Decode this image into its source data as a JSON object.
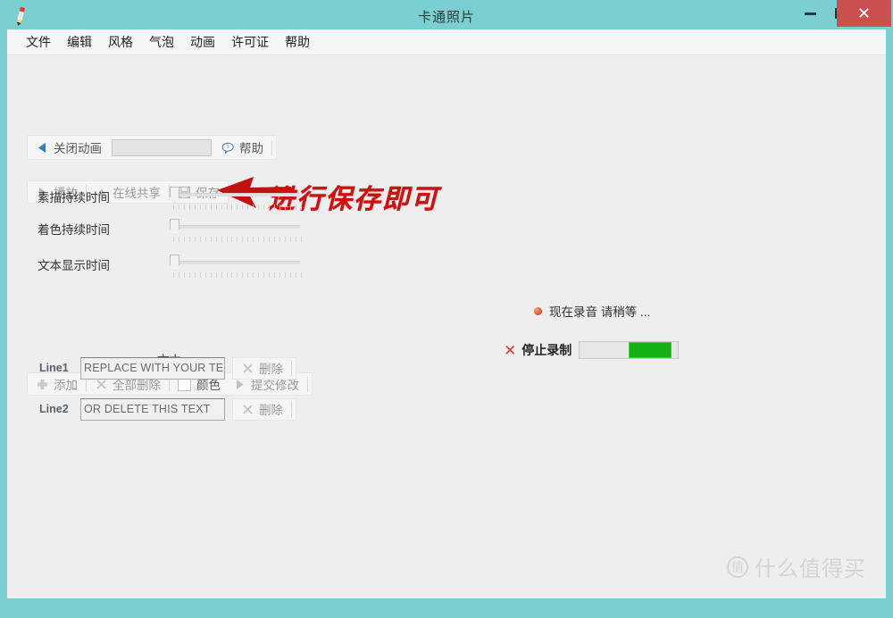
{
  "window": {
    "title": "卡通照片",
    "icon": "pencil-icon",
    "controls": {
      "minimize": "minimize-icon",
      "maximize": "maximize-icon",
      "close": "✕"
    },
    "accent_color": "#7ccfd0",
    "close_color": "#c9504f"
  },
  "menu": {
    "items": [
      {
        "label": "文件"
      },
      {
        "label": "编辑"
      },
      {
        "label": "风格"
      },
      {
        "label": "气泡"
      },
      {
        "label": "动画"
      },
      {
        "label": "许可证"
      },
      {
        "label": "帮助"
      }
    ]
  },
  "anim_toolbar": {
    "close_anim_label": "关闭动画",
    "textbox_value": "",
    "help_label": "帮助"
  },
  "play_toolbar": {
    "play_label": "播放",
    "share_label": "在线共享",
    "save_label": "保存"
  },
  "sliders": [
    {
      "label": "素描持续时间",
      "value": 0,
      "ticks": 25
    },
    {
      "label": "着色持续时间",
      "value": 0,
      "ticks": 25
    },
    {
      "label": "文本显示时间",
      "value": 0,
      "ticks": 25
    }
  ],
  "text_section": {
    "section_label": "文本",
    "toolbar": {
      "add_label": "添加",
      "delete_all_label": "全部删除",
      "color_label": "颜色",
      "color_swatch": "#ffffff",
      "submit_label": "提交修改"
    },
    "lines": [
      {
        "label": "Line1",
        "value": "REPLACE WITH YOUR TEXT",
        "delete_label": "删除"
      },
      {
        "label": "Line2",
        "value": "OR DELETE THIS TEXT",
        "delete_label": "删除"
      }
    ]
  },
  "recording": {
    "status_text": "现在录音 请稍等 ...",
    "stop_label": "停止录制",
    "progress_percent": 43,
    "progress_color": "#16b016",
    "dot_color": "#d4502a"
  },
  "annotation": {
    "text": "进行保存即可",
    "color": "#cc1111"
  },
  "watermark": {
    "logo_text": "值",
    "text": "什么值得买"
  }
}
